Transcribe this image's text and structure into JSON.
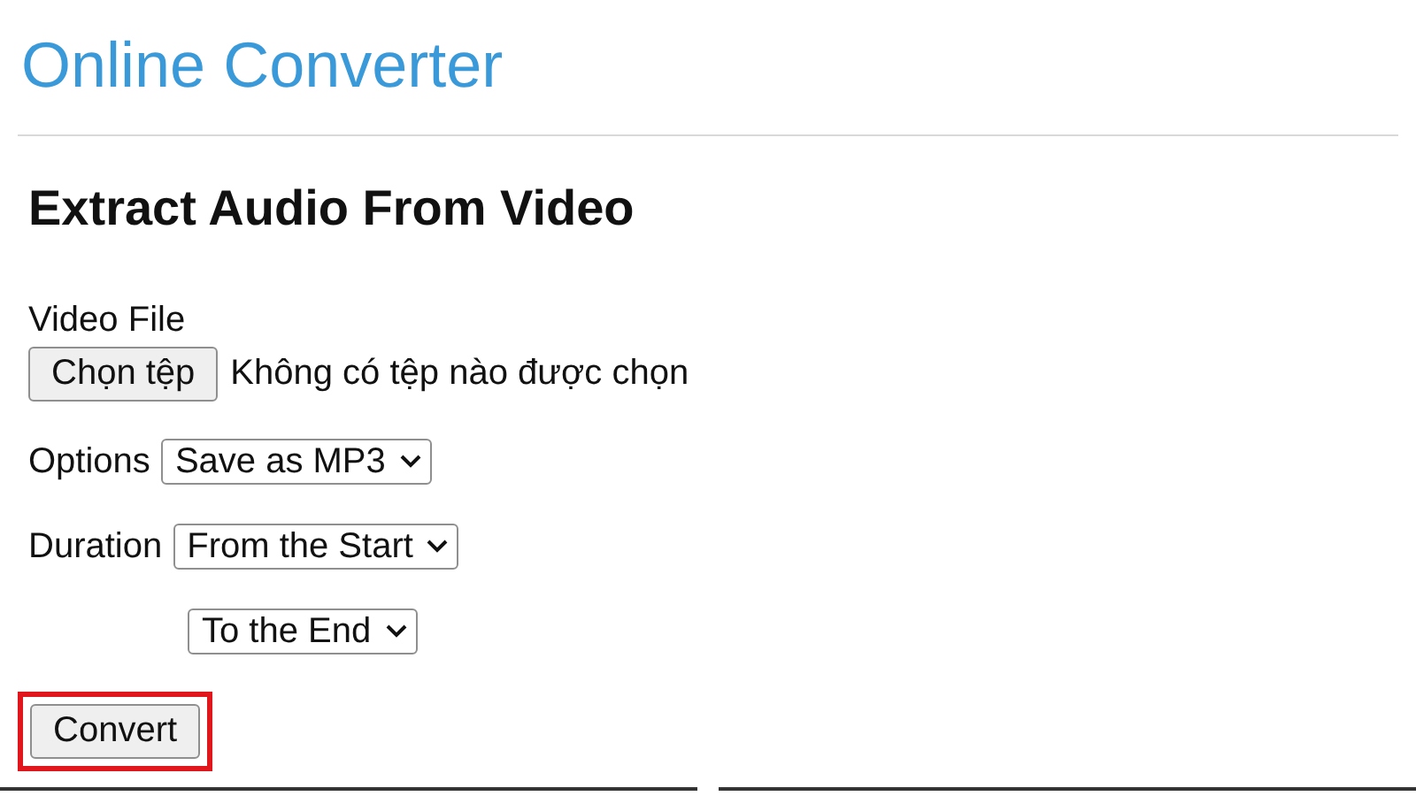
{
  "header": {
    "title": "Online Converter"
  },
  "form": {
    "heading": "Extract Audio From Video",
    "file": {
      "label": "Video File",
      "button": "Chọn tệp",
      "status": "Không có tệp nào được chọn"
    },
    "fields": [
      {
        "label": "Options",
        "value": "Save as MP3"
      },
      {
        "label": "Duration",
        "value": "From the Start"
      },
      {
        "value": "To the End"
      }
    ],
    "submit": {
      "label": "Convert",
      "highlighted": true
    }
  }
}
